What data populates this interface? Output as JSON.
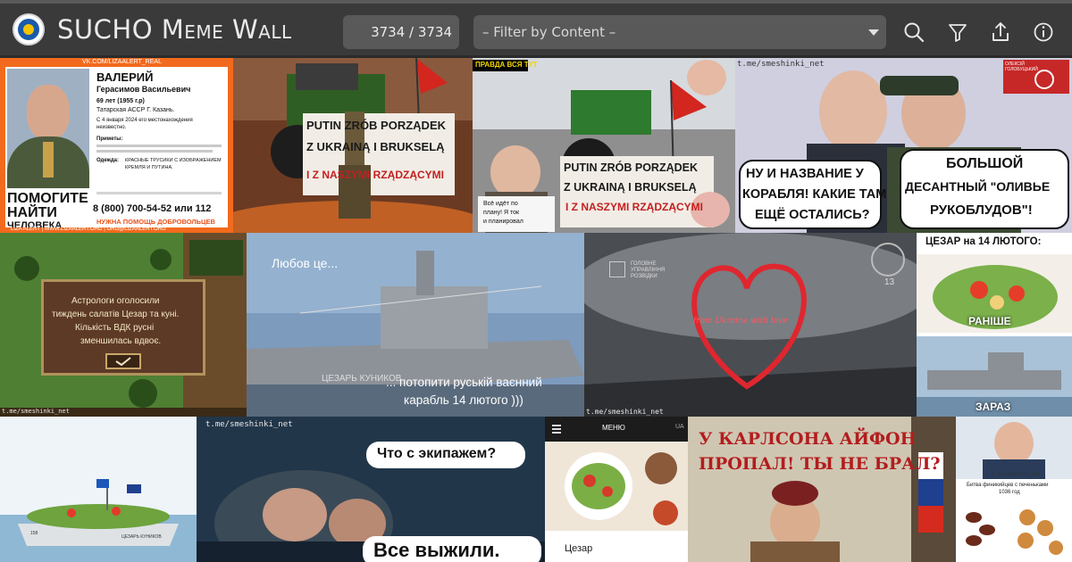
{
  "header": {
    "title": "SUCHO Meme Wall",
    "counter": "3734 / 3734",
    "filter_placeholder": "– Filter by Content –"
  },
  "icons": [
    "search-icon",
    "filter-icon",
    "share-icon",
    "info-icon"
  ],
  "tiles": {
    "t1": {
      "source": "VK.COM/LIZAALERT_REAL",
      "name": "ВАЛЕРИЙ",
      "patronymic": "Герасимов Васильевич",
      "age": "69 лет (1955 г.р)",
      "place": "Татарская АССР Г. Казань.",
      "date_line": "С 4 января 2024 его местонахождения",
      "date_line2": "неизвестно.",
      "signs": "Приметы:",
      "clothes": "Одежда:",
      "clothes_value": "КРАСНЫЕ ТРУСИКИ С ИЗОБРАЖЕНИЕМ",
      "clothes_value2": "КРЕМЛЯ И ПУТИНА.",
      "headline1": "ПОМОГИТЕ",
      "headline2": "НАЙТИ",
      "headline3": "ЧЕЛОВЕКА",
      "phone": "8 (800) 700-54-52 или 112",
      "help": "НУЖНА ПОМОЩЬ ДОБРОВОЛЬЦЕВ",
      "footer": "LIZA ALERT | WWW.LIZAALERT.ORG | ORG@LIZAALERT.ORG"
    },
    "t2": {
      "line1": "PUTIN ZRÓB PORZĄDEK",
      "line2": "Z UKRAINĄ I BRUKSELĄ",
      "line3": "I Z NASZYMI RZĄDZĄCYMI"
    },
    "t3": {
      "tag": "ПРАВДА ВСЯ ТУТ",
      "line1": "PUTIN ZRÓB PORZĄDEK",
      "line2": "Z UKRAINĄ I BRUKSELĄ",
      "line3": "I Z NASZYMI RZĄDZĄCYMI",
      "sign1": "Всё идёт по",
      "sign2": "плану! Я ток",
      "sign3": "и планировал"
    },
    "t4": {
      "watermark": "t.me/smeshinki_net",
      "author": "ОЛЕКСІЙ ГОЛОБУЦЬКИЙ",
      "left1": "НУ И НАЗВАНИЕ У",
      "left2": "КОРАБЛЯ! КАКИЕ ТАМ",
      "left3": "ЕЩЁ ОСТАЛИСЬ?",
      "right1": "БОЛЬШОЙ",
      "right2": "ДЕСАНТНЫЙ \"ОЛИВЬЕ",
      "right3": "РУКОБЛУДОВ\"!"
    },
    "t5": {
      "line1": "Астрологи оголосили",
      "line2": "тиждень салатів Цезар та куні.",
      "line3": "Кількість ВДК русні",
      "line4": "зменшилась вдвоє.",
      "watermark": "t.me/smeshinki_net"
    },
    "t6": {
      "top": "Любов це...",
      "bottom1": "... потопити руській ваєнний",
      "bottom2": "карабль 14 лютого )))",
      "ship_name": "ЦЕЗАРЬ КУНИКОВ"
    },
    "t7": {
      "agency1": "ГОЛОВНЕ",
      "agency2": "УПРАВЛІННЯ",
      "agency3": "РОЗВІДКИ",
      "heart_text": "from Ukraine with love",
      "watermark": "t.me/smeshinki_net",
      "badge": "13"
    },
    "t8": {
      "title": "ЦЕЗАР на 14 ЛЮТОГО:",
      "before": "РАНІШЕ",
      "now": "ЗАРАЗ"
    },
    "t9": {
      "ship_label": "ЦЕЗАРЬ КУНИКОВ",
      "hull_number": "158"
    },
    "t10": {
      "watermark": "t.me/smeshinki_net",
      "bubble1": "Что с экипажем?",
      "bubble2": "Все выжили."
    },
    "t11": {
      "menu": "МЕНЮ",
      "lang": "UA",
      "item": "Цезар"
    },
    "t12": {
      "line1": "У КАРЛСОНА АЙФОН",
      "line2": "ПРОПАЛ! ТЫ НЕ БРАЛ?"
    },
    "t13": {
      "watermark": "t.me/smeshinki_net",
      "caption1": "Битва финикийцев с печеньками",
      "caption2": "1036 год"
    }
  }
}
